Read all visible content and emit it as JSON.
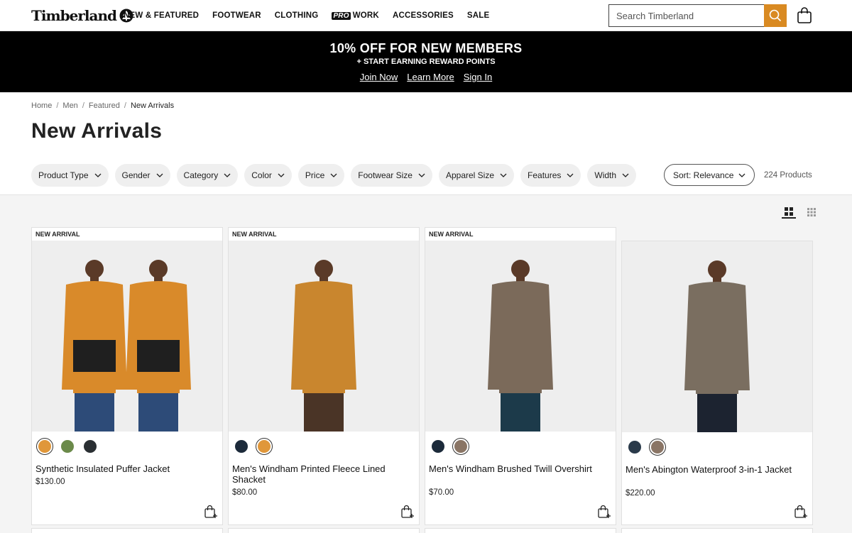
{
  "header": {
    "logo_text": "Timberland",
    "nav": [
      {
        "label": "NEW & FEATURED"
      },
      {
        "label": "FOOTWEAR"
      },
      {
        "label": "CLOTHING"
      },
      {
        "label": "WORK",
        "badge": "PRO"
      },
      {
        "label": "ACCESSORIES"
      },
      {
        "label": "SALE"
      }
    ],
    "search_placeholder": "Search Timberland",
    "accent_color": "#d98a22"
  },
  "promo": {
    "title": "10% OFF FOR NEW MEMBERS",
    "subtitle": "+ START EARNING REWARD POINTS",
    "links": [
      "Join Now",
      "Learn More",
      "Sign In"
    ]
  },
  "breadcrumb": [
    "Home",
    "Men",
    "Featured",
    "New Arrivals"
  ],
  "page_title": "New Arrivals",
  "filters": [
    "Product Type",
    "Gender",
    "Category",
    "Color",
    "Price",
    "Footwear Size",
    "Apparel Size",
    "Features",
    "Width"
  ],
  "sort_label": "Sort: Relevance",
  "product_count": "224 Products",
  "products": [
    {
      "badge": "NEW ARRIVAL",
      "name": "Synthetic Insulated Puffer Jacket",
      "price": "$130.00",
      "swatches": [
        "#e0973a",
        "#6b8a4a",
        "#2a2f33"
      ],
      "selected": 0
    },
    {
      "badge": "NEW ARRIVAL",
      "name": "Men's Windham Printed Fleece Lined Shacket",
      "price": "$80.00",
      "swatches": [
        "#1c2a3a",
        "#e0973a"
      ],
      "selected": 1
    },
    {
      "badge": "NEW ARRIVAL",
      "name": "Men's Windham Brushed Twill Overshirt",
      "price": "$70.00",
      "swatches": [
        "#1c2a3a",
        "#8a7565"
      ],
      "selected": 1
    },
    {
      "badge": "",
      "name": "Men's Abington Waterproof 3-in-1 Jacket",
      "price": "$220.00",
      "swatches": [
        "#2a3a4a",
        "#8a7565"
      ],
      "selected": 1
    }
  ]
}
